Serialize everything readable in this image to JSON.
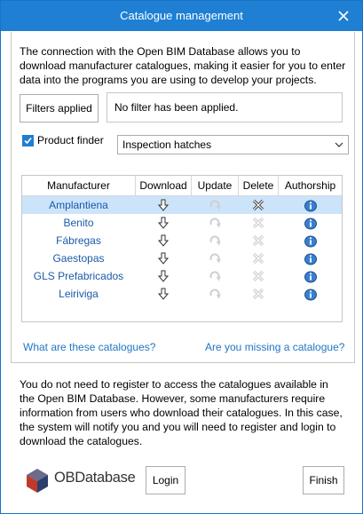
{
  "window": {
    "title": "Catalogue management"
  },
  "intro_text": "The connection with the Open BIM Database allows you to download manufacturer catalogues, making it easier for you to enter data into the programs you are using to develop your projects.",
  "filters": {
    "button_label": "Filters applied",
    "status": "No filter has been applied."
  },
  "product_finder": {
    "label": "Product finder",
    "checked": true,
    "selected": "Inspection hatches"
  },
  "table": {
    "headers": [
      "Manufacturer",
      "Download",
      "Update",
      "Delete",
      "Authorship"
    ],
    "rows": [
      {
        "manufacturer": "Amplantiena",
        "selected": true,
        "delete_enabled": true
      },
      {
        "manufacturer": "Benito",
        "selected": false,
        "delete_enabled": false
      },
      {
        "manufacturer": "Fábregas",
        "selected": false,
        "delete_enabled": false
      },
      {
        "manufacturer": "Gaestopas",
        "selected": false,
        "delete_enabled": false
      },
      {
        "manufacturer": "GLS Prefabricados",
        "selected": false,
        "delete_enabled": false
      },
      {
        "manufacturer": "Leiriviga",
        "selected": false,
        "delete_enabled": false
      }
    ],
    "icons": {
      "download": "download-arrow-icon",
      "update": "update-refresh-icon",
      "delete": "delete-x-icon",
      "authorship": "info-icon"
    }
  },
  "links": {
    "what_catalogues": "What are these catalogues?",
    "missing_catalogue": "Are you missing a catalogue?"
  },
  "notice_text": "You do not need to register to access the catalogues available in the Open BIM Database. However, some manufacturers require information from users who download their catalogues. In this case, the system will notify you and you will need to register and login to download the catalogues.",
  "footer": {
    "logo_prefix": "OB",
    "logo_suffix": "Database",
    "login_label": "Login",
    "finish_label": "Finish"
  },
  "colors": {
    "titlebar": "#1e7fd3",
    "link": "#1f76c4",
    "selected_row": "#cce4fa"
  }
}
